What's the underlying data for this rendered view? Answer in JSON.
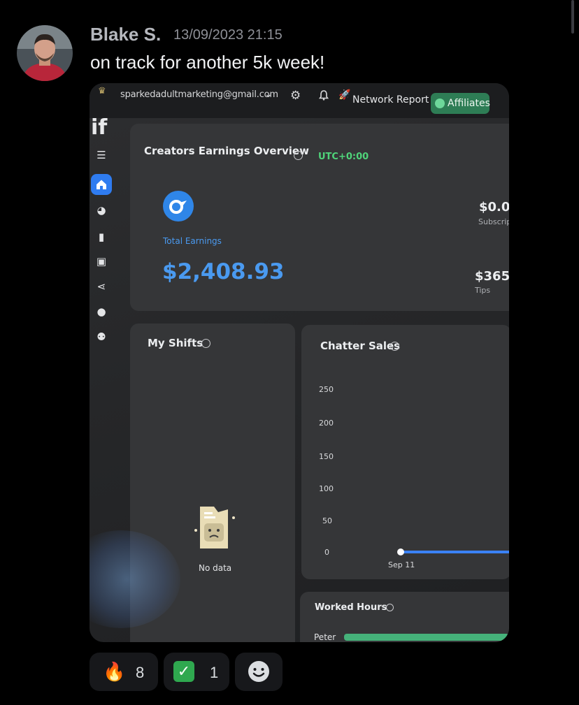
{
  "message": {
    "username": "Blake S.",
    "timestamp": "13/09/2023 21:15",
    "text": "on track for another 5k week!"
  },
  "screenshot": {
    "topbar": {
      "email": "sparkedadultmarketing@gmail.com",
      "network_report": "Network Report",
      "affiliates": "Affiliates"
    },
    "brand": "if",
    "overview": {
      "title": "Creators Earnings Overview",
      "timezone": "UTC+0:00",
      "total_label": "Total Earnings",
      "total_amount": "$2,408.93",
      "subscriptions_value": "$0.0",
      "subscriptions_label": "Subscrip",
      "tips_value": "$365.",
      "tips_label": "Tips"
    },
    "shifts": {
      "title": "My Shifts",
      "empty_text": "No data"
    },
    "chatter_sales": {
      "title": "Chatter Sales"
    },
    "worked_hours": {
      "title": "Worked Hours",
      "row_label": "Peter"
    }
  },
  "chart_data": {
    "type": "line",
    "title": "Chatter Sales",
    "x": [
      "Sep 11"
    ],
    "y_ticks": [
      250,
      200,
      150,
      100,
      50,
      0
    ],
    "ylim": [
      0,
      250
    ],
    "series": [
      {
        "values": [
          0
        ],
        "color": "#3b82f6"
      }
    ]
  },
  "reactions": [
    {
      "emoji": "🔥",
      "count": "8"
    },
    {
      "emoji": "✅",
      "count": "1"
    }
  ],
  "colors": {
    "background": "#000000",
    "accent_blue": "#4a9af0",
    "affiliates_green": "#2e7d55",
    "utc_green": "#4fd47a"
  }
}
